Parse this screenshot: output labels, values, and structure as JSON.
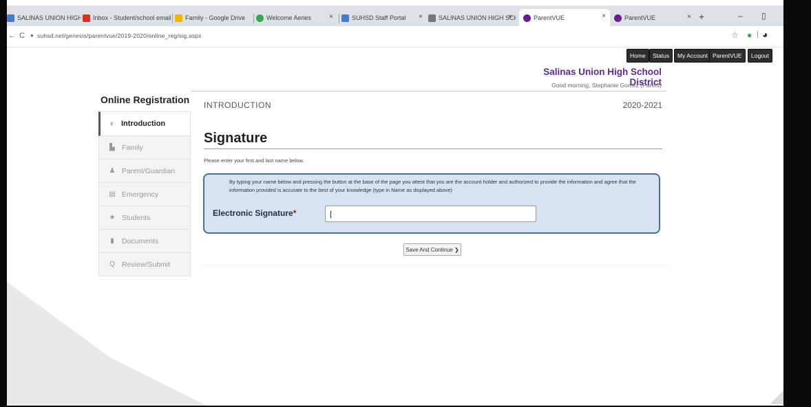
{
  "browser": {
    "tabs": [
      {
        "label": "SALINAS UNION HIGH SCH...",
        "color": "#4a7bc8"
      },
      {
        "label": "Inbox - Student/school email",
        "color": "#d93025"
      },
      {
        "label": "Family - Google Drive",
        "color": "#f4b400"
      },
      {
        "label": "Welcome Aeries",
        "color": "#34a853"
      },
      {
        "label": "SUHSD Staff Portal",
        "color": "#4a7bc8"
      },
      {
        "label": "SALINAS UNION HIGH SCH...",
        "color": "#777777"
      },
      {
        "label": "ParentVUE",
        "color": "#6a1b9a",
        "active": true
      },
      {
        "label": "ParentVUE",
        "color": "#6a1b9a"
      }
    ],
    "new_tab": "+",
    "minimize": "–",
    "maximize": "▯",
    "url": "suhsd.net/genesis/parentvue/2019-2020/online_reg/sig.aspx",
    "back": "←",
    "reload": "C",
    "star": "☆"
  },
  "topnav": {
    "home": "Home",
    "status": "Status",
    "my_account": "My Account",
    "parentvue": "ParentVUE",
    "logout": "Logout"
  },
  "header": {
    "district": "Salinas Union High School District",
    "sub": "Good morning, Stephanie Gomez (Parent)"
  },
  "sidebar": {
    "title": "Online Registration",
    "items": [
      {
        "label": "Introduction",
        "icon": "lightbulb-icon",
        "glyph": "♀",
        "active": true
      },
      {
        "label": "Family",
        "icon": "building-icon",
        "glyph": "▙"
      },
      {
        "label": "Parent/Guardian",
        "icon": "user-icon",
        "glyph": "♟"
      },
      {
        "label": "Emergency",
        "icon": "lock-icon",
        "glyph": "▤"
      },
      {
        "label": "Students",
        "icon": "star-icon",
        "glyph": "★"
      },
      {
        "label": "Documents",
        "icon": "document-icon",
        "glyph": "▮"
      },
      {
        "label": "Review/Submit",
        "icon": "search-icon",
        "glyph": "Q"
      }
    ]
  },
  "main": {
    "section": "INTRODUCTION",
    "year": "2020-2021",
    "title": "Signature",
    "instruction": "Please enter your first and last name below.",
    "agreement": "By typing your name below and pressing the button at the base of the page you attest that you are the account holder and authorized to provide the information and agree that the information provided is accurate to the best of your knowledge (type in Name as displayed above)",
    "sig_label": "Electronic Signature",
    "sig_required": "*",
    "sig_value": "|",
    "save_button": "Save And Continue ❯"
  },
  "colors": {
    "district_purple": "#5b2c8c",
    "sig_box_bg": "#d7e2f2",
    "sig_box_border": "#4a6d9a"
  }
}
